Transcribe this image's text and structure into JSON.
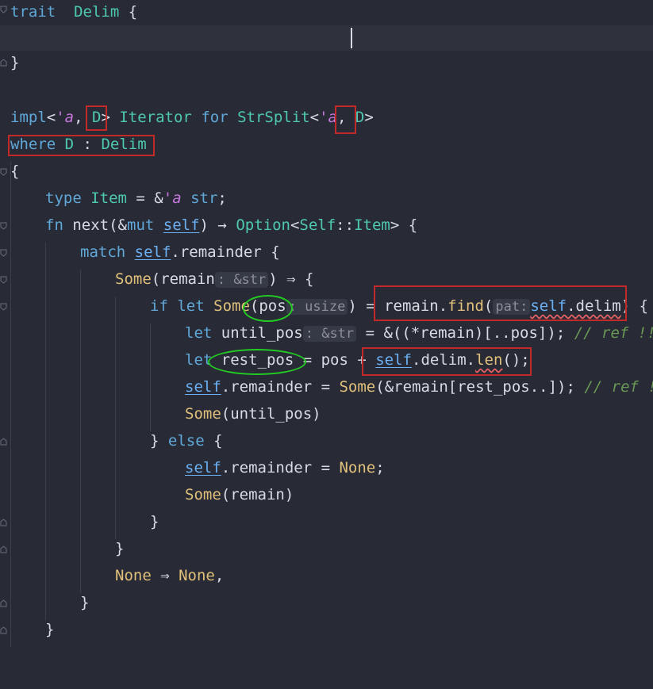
{
  "lines": {
    "l1": {
      "trait": "trait",
      "name": "Delim",
      "brace": "{"
    },
    "l3": {
      "brace": "}"
    },
    "l5": {
      "impl": "impl",
      "lt1": "<",
      "a1": "'a",
      "c1": ", ",
      "D": "D",
      "g1": ">",
      "iter": "Iterator",
      "for": "for",
      "strsplit": "StrSplit",
      "lt2": "<",
      "a2": "'a",
      "c2": ", ",
      "D2": "D",
      "g2": ">"
    },
    "l6": {
      "where": "where",
      "D": "D",
      "colon": " : ",
      "delim": "Delim"
    },
    "l7": {
      "brace": "{"
    },
    "l8": {
      "type": "type",
      "item": "Item",
      "eq": " = &",
      "a": "'a",
      "str": "str",
      "semi": ";"
    },
    "l9": {
      "fn": "fn",
      "next": "next",
      "p1": "(&",
      "mut": "mut",
      "self": "self",
      "p2": ") → ",
      "option": "Option",
      "lt": "<",
      "selft": "Self",
      "cc": "::",
      "item": "Item",
      "gt": ">",
      "brace": " {"
    },
    "l10": {
      "match": "match",
      "self": "self",
      "rest": ".remainder {"
    },
    "l11": {
      "some": "Some",
      "p1": "(remain",
      "hint": ": &str",
      "p2": ") ⇒ {"
    },
    "l12": {
      "if": "if",
      "let": "let",
      "some": "Some",
      "p1": "(pos",
      "hint": ": usize",
      "p2": ") = ",
      "remain": "remain.",
      "find": "find",
      "p3": "(",
      "hint2": "pat:",
      "self": "self",
      "delim": ".delim",
      "p4": ") {"
    },
    "l13": {
      "let": "let",
      "var": "until_pos",
      "hint": ": &str",
      "rest": " = &((*remain)[..pos]); ",
      "comment": "// ref !!"
    },
    "l14": {
      "let": "let",
      "var": " rest_pos",
      "rest": " = pos + ",
      "self": "self",
      "delim": ".delim.",
      "len": "len",
      "end": "();"
    },
    "l15": {
      "self": "self",
      "rest": ".remainder = ",
      "some": "Some",
      "rest2": "(&remain[rest_pos..]); ",
      "comment": "// ref !!"
    },
    "l16": {
      "some": "Some",
      "rest": "(until_pos)"
    },
    "l17": {
      "b": "} ",
      "else": "else",
      "b2": " {"
    },
    "l18": {
      "self": "self",
      "rest": ".remainder = ",
      "none": "None",
      "semi": ";"
    },
    "l19": {
      "some": "Some",
      "rest": "(remain)"
    },
    "l20": {
      "brace": "}"
    },
    "l21": {
      "brace": "}"
    },
    "l22": {
      "none": "None",
      "arrow": " ⇒ ",
      "none2": "None",
      "comma": ","
    },
    "l23": {
      "brace": "}"
    },
    "l24": {
      "brace": "}"
    }
  },
  "colors": {
    "background": "#282a36",
    "keyword": "#5fa8d8",
    "type": "#4ec9b0",
    "function": "#e0c07a",
    "annotation_red": "#c22a2a",
    "annotation_green": "#22cc22"
  }
}
